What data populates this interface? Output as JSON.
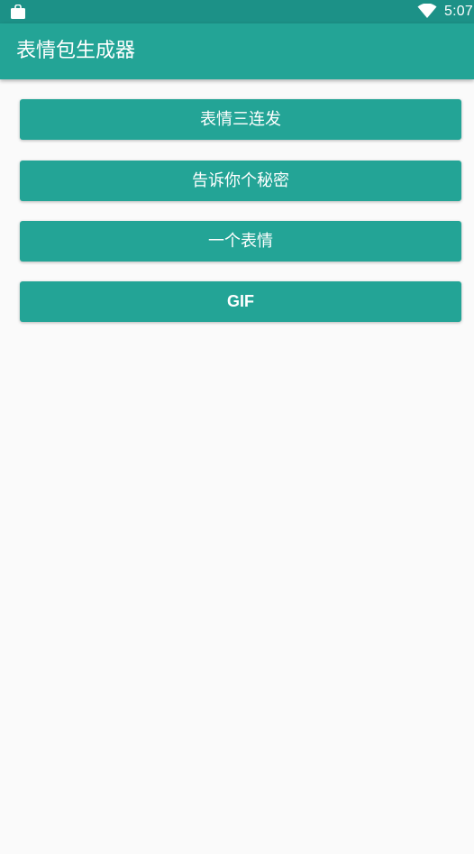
{
  "status_bar": {
    "time": "5:07",
    "icons": [
      "shopping-bag-icon",
      "wifi-icon"
    ]
  },
  "app_bar": {
    "title": "表情包生成器"
  },
  "buttons": [
    {
      "label": "表情三连发"
    },
    {
      "label": "告诉你个秘密"
    },
    {
      "label": "一个表情"
    },
    {
      "label": "GIF"
    }
  ],
  "colors": {
    "status_bar": "#1c9187",
    "primary": "#23a496",
    "background": "#fafafa",
    "text_on_primary": "#ffffff"
  }
}
